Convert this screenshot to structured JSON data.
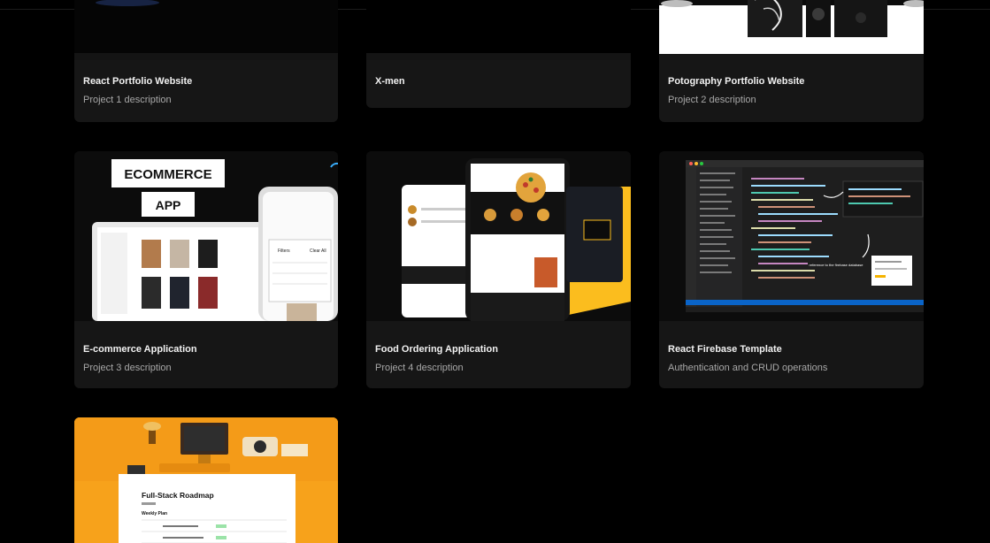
{
  "projects": [
    {
      "title": "React Portfolio Website",
      "description": "Project 1 description"
    },
    {
      "title": "X-men",
      "description": ""
    },
    {
      "title": "Potography Portfolio Website",
      "description": "Project 2 description"
    },
    {
      "title": "E-commerce Application",
      "description": "Project 3 description"
    },
    {
      "title": "Food Ordering Application",
      "description": "Project 4 description"
    },
    {
      "title": "React Firebase Template",
      "description": "Authentication and CRUD operations"
    },
    {
      "title": "",
      "description": ""
    }
  ],
  "thumbnails": {
    "ecommerce": {
      "badge_1": "ECOMMERCE",
      "badge_2": "APP",
      "filters_label": "Filters",
      "clear_all": "Clear All"
    },
    "roadmap": {
      "title": "Full-Stack Roadmap",
      "subtitle": "Weekly Plan"
    },
    "firebase": {
      "note": "reference to the firebase database"
    }
  },
  "colors": {
    "background": "#000000",
    "card": "#161616",
    "title_text": "#f2f2f2",
    "desc_text": "#a8a8a8",
    "food_accent": "#fbbd1e",
    "roadmap_accent": "#f7a21b",
    "editor_bg": "#1e1e1e",
    "editor_status": "#0a64c8"
  }
}
